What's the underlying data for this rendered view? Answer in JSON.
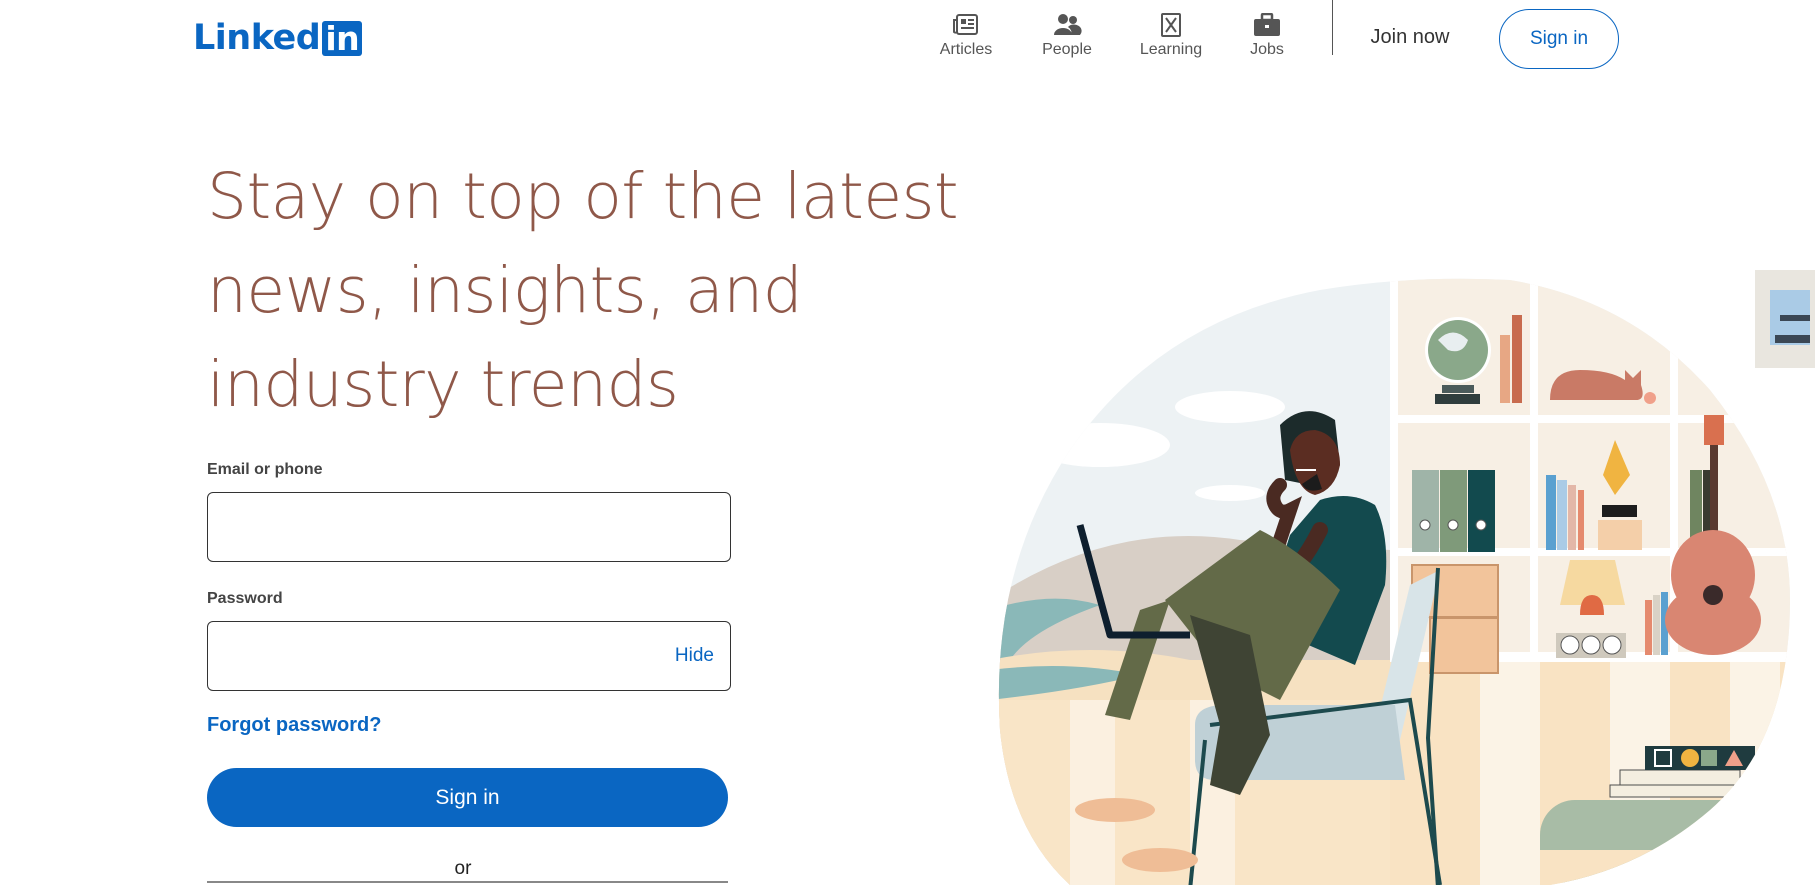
{
  "header": {
    "logo_text": "Linked",
    "logo_box_text": "in",
    "nav": [
      {
        "label": "Articles",
        "icon": "newspaper-icon"
      },
      {
        "label": "People",
        "icon": "people-icon"
      },
      {
        "label": "Learning",
        "icon": "learning-icon"
      },
      {
        "label": "Jobs",
        "icon": "briefcase-icon"
      }
    ],
    "join_label": "Join now",
    "signin_label": "Sign in"
  },
  "hero": {
    "lines": [
      "Stay on top of the latest",
      "news, insights, and",
      "industry trends"
    ]
  },
  "form": {
    "email_label": "Email or phone",
    "email_value": "",
    "password_label": "Password",
    "password_value": "",
    "hide_label": "Hide",
    "forgot_label": "Forgot password?",
    "signin_label": "Sign in",
    "or_label": "or"
  },
  "colors": {
    "brand": "#0a66c2",
    "hero_text": "#8f5849"
  }
}
